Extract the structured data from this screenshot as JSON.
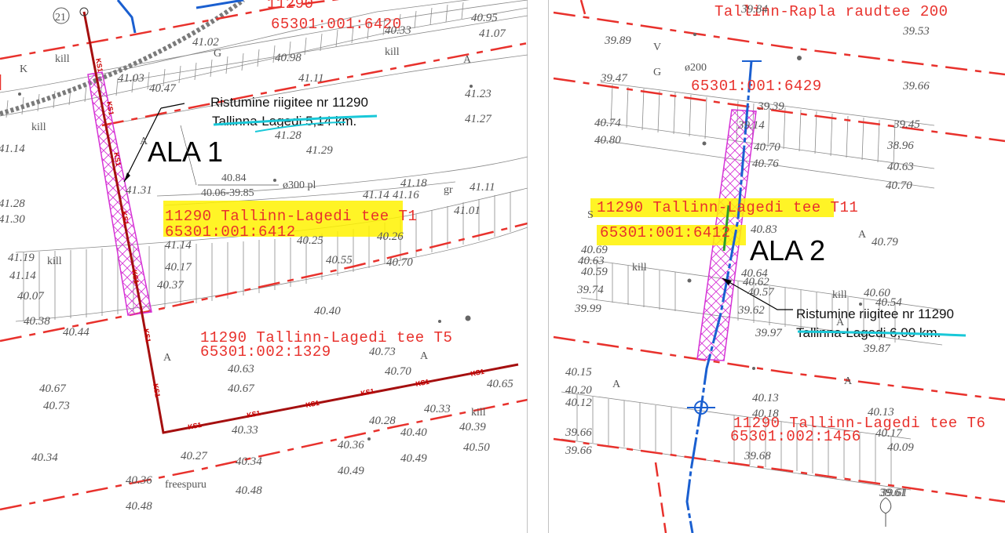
{
  "panels": [
    {
      "id": "ala1",
      "area_label": "ALA 1",
      "callout": {
        "line1": "Ristumine riigitee nr 11290",
        "line2": "Tallinna-Lagedi 5,14 km."
      },
      "parcels": [
        {
          "name": "11290 Tallinn-Lagedi tee T1",
          "code": "65301:001:6412",
          "highlight": true
        },
        {
          "name": "11290 Tallinn-Lagedi tee T5",
          "code": "65301:002:1329",
          "highlight": false
        },
        {
          "name": "11290",
          "code": "65301:001:6420",
          "highlight": false
        }
      ],
      "pipe_note": "ø300 pl",
      "dim_top": "40.84",
      "dim_bottom": "40.06-39.85",
      "line_label": "KS1",
      "marker": "21",
      "terms": [
        "kill",
        "kill",
        "kill",
        "kill",
        "kill",
        "freespuru",
        "gr",
        "A",
        "A",
        "A",
        "A",
        "G",
        "K"
      ],
      "elevations": [
        "41.07",
        "40.95",
        "40.33",
        "41.02",
        "40.98",
        "41.11",
        "41.03",
        "40.47",
        "41.23",
        "41.27",
        "41.14",
        "41.28",
        "41.29",
        "41.28",
        "41.30",
        "41.31",
        "41.18",
        "41.14",
        "41.16",
        "41.11",
        "41.01",
        "40.26",
        "40.25",
        "40.55",
        "40.70",
        "41.14",
        "41.19",
        "41.14",
        "40.17",
        "40.37",
        "40.07",
        "40.38",
        "40.44",
        "40.40",
        "40.73",
        "40.63",
        "40.70",
        "40.67",
        "40.67",
        "40.73",
        "40.34",
        "40.33",
        "40.65",
        "40.39",
        "40.28",
        "40.40",
        "40.33",
        "40.36",
        "40.50",
        "40.34",
        "40.27",
        "40.49",
        "40.49",
        "40.36",
        "40.48",
        "40.48"
      ]
    },
    {
      "id": "ala2",
      "area_label": "ALA 2",
      "callout": {
        "line1": "Ristumine riigitee nr 11290",
        "line2": "Tallinna-Lagedi 6,00 km."
      },
      "parcels": [
        {
          "name": "Tallinn-Rapla raudtee 200",
          "code": "65301:001:6429",
          "highlight": false
        },
        {
          "name": "11290 Tallinn-Lagedi tee T11",
          "code": "65301:001:6412",
          "highlight": true
        },
        {
          "name": "11290 Tallinn-Lagedi tee T6",
          "code": "65301:002:1456",
          "highlight": false
        }
      ],
      "pipe_note": "ø200",
      "terms": [
        "kill",
        "kill",
        "A",
        "A",
        "A",
        "A",
        "G",
        "V",
        "S"
      ],
      "elevations": [
        "39.84",
        "39.53",
        "39.89",
        "39.66",
        "39.47",
        "39.39",
        "39.14",
        "39.45",
        "40.74",
        "40.80",
        "40.70",
        "40.76",
        "38.96",
        "40.63",
        "40.70",
        "40.83",
        "40.79",
        "40.69",
        "40.63",
        "40.59",
        "40.64",
        "40.62",
        "40.57",
        "39.74",
        "39.99",
        "39.62",
        "40.60",
        "40.54",
        "39.97",
        "39.87",
        "40.15",
        "40.20",
        "40.12",
        "40.13",
        "40.18",
        "40.13",
        "39.66",
        "39.66",
        "40.17",
        "40.09",
        "39.68",
        "39.61",
        "39.61"
      ]
    }
  ],
  "colors": {
    "parcel_line": "#e8312c",
    "sewer_line": "#a50f0f",
    "water_line": "#1a5fd0",
    "crossing_hatch": "#d633d6",
    "highlight": "#fff200",
    "strike": "#19c8d8",
    "survey_line": "#8a8a8a"
  }
}
